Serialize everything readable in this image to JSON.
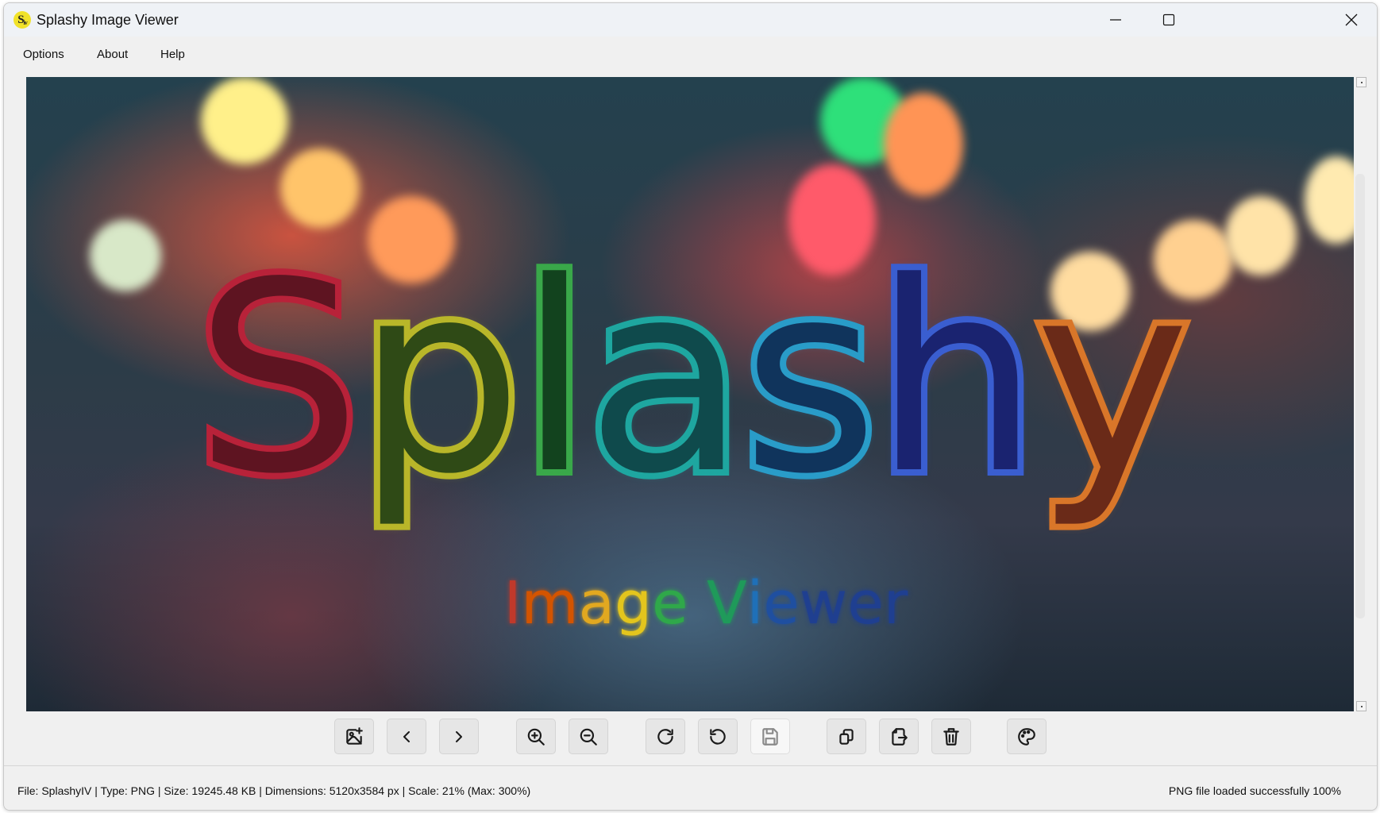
{
  "window": {
    "title": "Splashy Image Viewer",
    "app_icon_letters": "S",
    "app_icon_sub": "iv",
    "controls": [
      "minimize",
      "maximize",
      "close"
    ]
  },
  "menu": {
    "items": [
      {
        "label": "Options"
      },
      {
        "label": "About"
      },
      {
        "label": "Help"
      }
    ]
  },
  "image": {
    "alt": "Splashy Image Viewer splash artwork",
    "headline_letters": [
      {
        "char": "S",
        "color": "#b8233a",
        "inner": "#5e1421"
      },
      {
        "char": "p",
        "color": "#b9b72a",
        "inner": "#2f4a16"
      },
      {
        "char": "l",
        "color": "#3aa84a",
        "inner": "#12431e"
      },
      {
        "char": "a",
        "color": "#1fa7a0",
        "inner": "#0f4a4c"
      },
      {
        "char": "s",
        "color": "#2a9cc8",
        "inner": "#10345c"
      },
      {
        "char": "h",
        "color": "#3b5fd0",
        "inner": "#1a2370"
      },
      {
        "char": "y",
        "color": "#d9772a",
        "inner": "#6a2a18"
      }
    ],
    "subtitle_letters": [
      {
        "char": "I",
        "color": "#c0392b"
      },
      {
        "char": "m",
        "color": "#d35400"
      },
      {
        "char": "a",
        "color": "#e1a820"
      },
      {
        "char": "g",
        "color": "#e3c51d"
      },
      {
        "char": "e",
        "color": "#2fa84a"
      },
      {
        "char": " ",
        "color": "#ffffff"
      },
      {
        "char": "V",
        "color": "#1f9a5a"
      },
      {
        "char": "i",
        "color": "#1f70b8"
      },
      {
        "char": "e",
        "color": "#1f4fa0"
      },
      {
        "char": "w",
        "color": "#1f3f90"
      },
      {
        "char": "e",
        "color": "#1f3f90"
      },
      {
        "char": "r",
        "color": "#1f3f90"
      }
    ]
  },
  "toolbar": {
    "buttons": [
      {
        "name": "open-image",
        "icon": "image-add-icon",
        "enabled": true
      },
      {
        "name": "previous",
        "icon": "chevron-left-icon",
        "enabled": true
      },
      {
        "name": "next",
        "icon": "chevron-right-icon",
        "enabled": true
      },
      {
        "name": "zoom-in",
        "icon": "zoom-in-icon",
        "enabled": true
      },
      {
        "name": "zoom-out",
        "icon": "zoom-out-icon",
        "enabled": true
      },
      {
        "name": "rotate-clockwise",
        "icon": "rotate-cw-icon",
        "enabled": true
      },
      {
        "name": "rotate-counterclockwise",
        "icon": "rotate-ccw-icon",
        "enabled": true
      },
      {
        "name": "save",
        "icon": "save-icon",
        "enabled": false
      },
      {
        "name": "copy",
        "icon": "copy-icon",
        "enabled": true
      },
      {
        "name": "export",
        "icon": "file-export-icon",
        "enabled": true
      },
      {
        "name": "delete",
        "icon": "trash-icon",
        "enabled": true
      },
      {
        "name": "theme",
        "icon": "palette-icon",
        "enabled": true
      }
    ]
  },
  "status": {
    "file_info": "File: SplashyIV | Type: PNG | Size: 19245.48 KB | Dimensions: 5120x3584 px | Scale: 21% (Max: 300%)",
    "message": "PNG file loaded successfully 100%",
    "file_name": "SplashyIV",
    "file_type": "PNG",
    "file_size": "19245.48 KB",
    "dimensions": "5120x3584 px",
    "scale": "21%",
    "max_scale": "300%",
    "load_progress": "100%"
  }
}
